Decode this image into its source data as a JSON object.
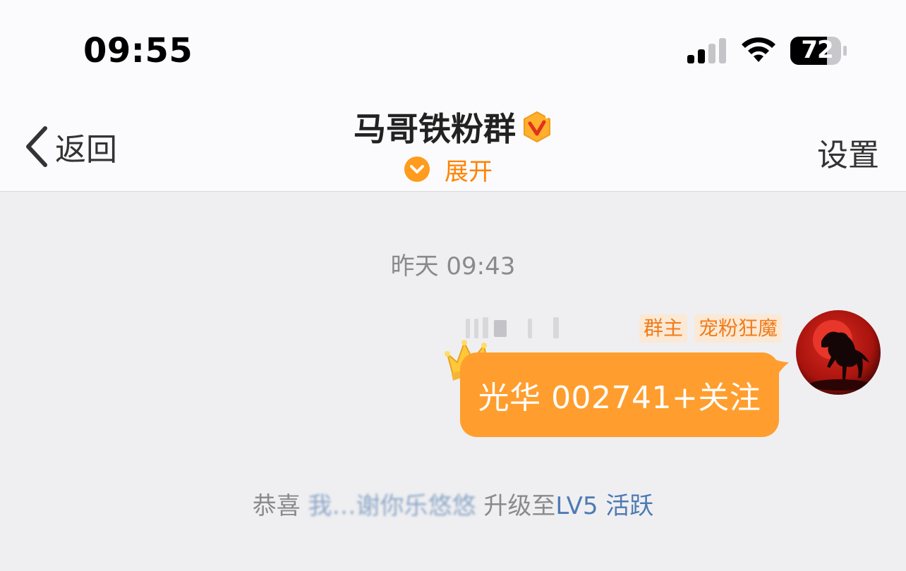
{
  "status_bar": {
    "time": "09:55",
    "battery": "72"
  },
  "nav": {
    "back_label": "返回",
    "title": "马哥铁粉群",
    "expand_label": "展开",
    "settings_label": "设置"
  },
  "chat": {
    "timestamp": "昨天 09:43",
    "messages": [
      {
        "badges": [
          "群主",
          "宠粉狂魔"
        ],
        "text": "光华 002741+关注"
      }
    ],
    "system_message": {
      "prefix": "恭喜",
      "user": "我…谢你乐悠悠",
      "middle": "升级至",
      "level": "LV5 活跃"
    }
  },
  "colors": {
    "accent": "#ff8200",
    "bubble": "#ff9e2e",
    "link": "#4e7ab3",
    "background": "#efeff1"
  }
}
